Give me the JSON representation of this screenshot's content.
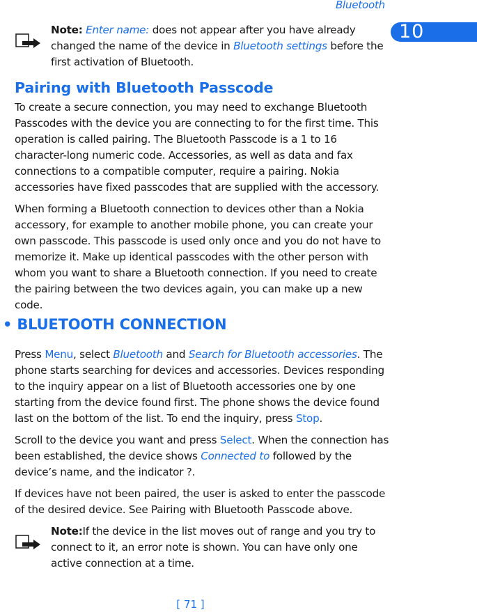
{
  "header": {
    "running_title": "Bluetooth",
    "chapter_number": "10"
  },
  "note_top": {
    "label": "Note:",
    "link1": "Enter name:",
    "text1": " does not appear after you have already changed the name of the device in ",
    "link2": "Bluetooth settings",
    "text2": " before the first activation of Bluetooth."
  },
  "pairing": {
    "title": "Pairing with Bluetooth Passcode",
    "para1": "To create a secure connection, you may need to exchange Bluetooth Passcodes with the device you are connecting to for the first time. This operation is called pairing. The Bluetooth Passcode is a 1 to 16 character-long numeric code. Accessories, as well as data and fax connections to a compatible computer, require a pairing. Nokia accessories have fixed passcodes that are supplied with the accessory.",
    "para2": "When forming a Bluetooth connection to devices other than a Nokia accessory, for example to another mobile phone, you can create your own passcode. This passcode is used only once and you do not have to memorize it. Make up identical passcodes with the other person with whom you want to share a Bluetooth connection. If you need to create the pairing between the two devices again, you can make up a new code."
  },
  "connection": {
    "title": "• BLUETOOTH CONNECTION",
    "para1": {
      "t1": "Press ",
      "menu": "Menu",
      "t2": ", select ",
      "bluetooth": "Bluetooth",
      "t3": " and ",
      "search": "Search for Bluetooth accessories",
      "t4": ". The phone starts searching for devices and accessories. Devices responding to the inquiry appear on a list of Bluetooth accessories one by one starting from the device found first. The phone shows the device found last on the bottom of the list. To end the inquiry, press ",
      "stop": "Stop",
      "t5": "."
    },
    "para2": {
      "t1": "Scroll to the device you want and press ",
      "select": "Select",
      "t2": ". When the connection has been established, the device shows ",
      "connected_to": "Connected to",
      "t3": " followed by the device’s name, and the indicator ?."
    },
    "para3": "If devices have not been paired, the user is asked to enter the passcode of the desired device. See Pairing with Bluetooth Passcode above."
  },
  "note_bottom": {
    "label": "Note:",
    "text": "If the device in the list moves out of range and you try to connect to it, an error note is shown.  You can have only one active connection at a time."
  },
  "footer": {
    "page_number": "[ 71 ]"
  },
  "colors": {
    "accent": "#1a6fe8",
    "text": "#1a1a1a"
  }
}
